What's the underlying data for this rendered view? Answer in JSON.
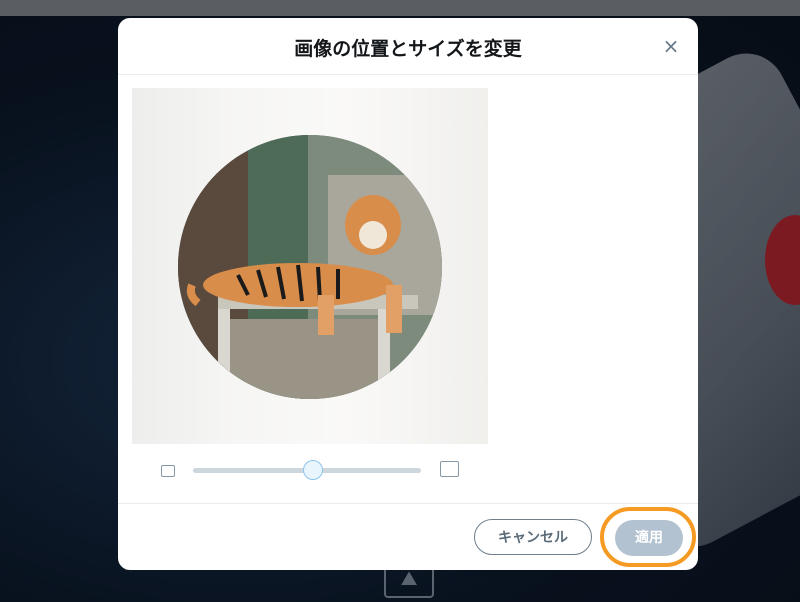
{
  "dialog": {
    "title": "画像の位置とサイズを変更",
    "close_label": "×"
  },
  "zoom": {
    "level": 0.52
  },
  "footer": {
    "cancel_label": "キャンセル",
    "apply_label": "適用"
  },
  "colors": {
    "highlight": "#f59a23",
    "apply_disabled": "#b3c2d0"
  },
  "icons": {
    "close": "close-icon",
    "zoom_out": "small-image-icon",
    "zoom_in": "large-image-icon",
    "background_image": "image-icon"
  }
}
